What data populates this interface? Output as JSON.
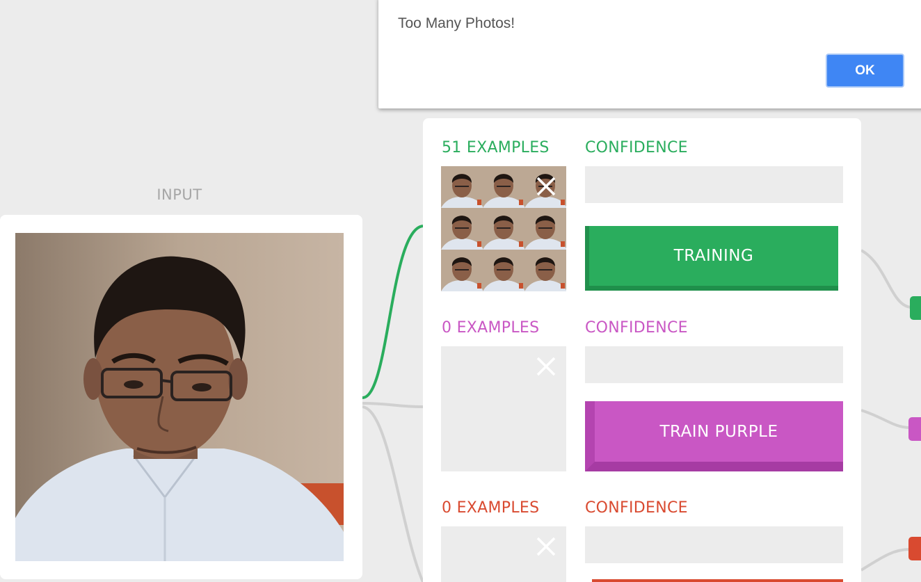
{
  "colors": {
    "green": "#2aad5d",
    "purple": "#c957c4",
    "red": "#d94a30",
    "ok_blue": "#3f86f4",
    "panel_gray": "#ececec"
  },
  "input": {
    "title": "INPUT",
    "webcam_alt": "webcam feed"
  },
  "classes": [
    {
      "examples_label": "51 EXAMPLES",
      "confidence_label": "CONFIDENCE",
      "button_label": "TRAINING",
      "color": "#2aad5d",
      "thumbnail_count": 9
    },
    {
      "examples_label": "0 EXAMPLES",
      "confidence_label": "CONFIDENCE",
      "button_label": "TRAIN PURPLE",
      "color": "#c957c4"
    },
    {
      "examples_label": "0 EXAMPLES",
      "confidence_label": "CONFIDENCE",
      "color": "#d94a30"
    }
  ],
  "dialog": {
    "message": "Too Many Photos!",
    "ok_label": "OK"
  },
  "icons": {
    "clear": "close-icon"
  }
}
